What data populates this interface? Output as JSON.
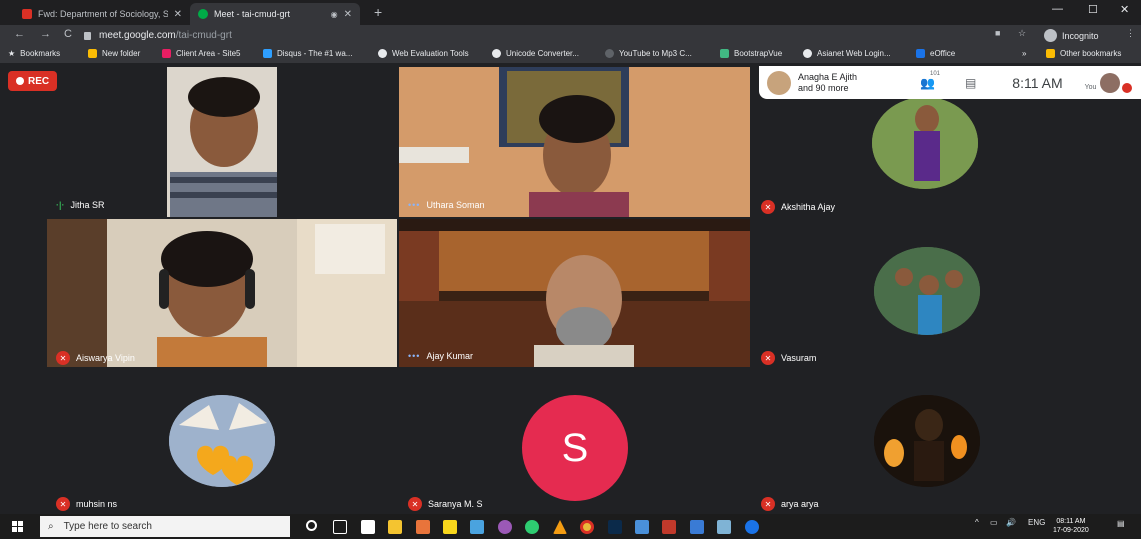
{
  "browser": {
    "tabs": [
      {
        "label": "Fwd: Department of Sociology, S",
        "active": false
      },
      {
        "label": "Meet - tai-cmud-grt",
        "active": true
      }
    ],
    "url_host": "meet.google.com",
    "url_path": "/tai-cmud-grt",
    "profile_label": "Incognito",
    "bookmarks": [
      "Bookmarks",
      "New folder",
      "Client Area - Site5",
      "Disqus - The #1 wa...",
      "Web Evaluation Tools",
      "Unicode Converter...",
      "YouTube to Mp3 C...",
      "BootstrapVue",
      "Asianet Web Login...",
      "eOffice",
      "Other bookmarks"
    ],
    "overflow_chevron": "»"
  },
  "meet": {
    "rec_label": "REC",
    "top_bar": {
      "people_name": "Anagha E Ajith",
      "people_more": "and 90 more",
      "participant_count": "101",
      "time": "8:11 AM",
      "self_label": "You"
    },
    "participants": [
      {
        "name": "Jitha SR",
        "status": "speaking"
      },
      {
        "name": "Uthara Soman",
        "status": "active"
      },
      {
        "name": "Akshitha Ajay",
        "status": "muted"
      },
      {
        "name": "Aiswarya Vipin",
        "status": "muted"
      },
      {
        "name": "Ajay Kumar",
        "status": "active"
      },
      {
        "name": "Vasuram",
        "status": "muted"
      },
      {
        "name": "muhsin ns",
        "status": "muted"
      },
      {
        "name": "Saranya M. S",
        "status": "muted",
        "initial": "S"
      },
      {
        "name": "arya arya",
        "status": "muted"
      }
    ]
  },
  "taskbar": {
    "search_placeholder": "Type here to search",
    "tray_lang": "ENG",
    "tray_arrow": "^",
    "clock_time": "08:11 AM",
    "clock_date": "17-09-2020"
  },
  "colors": {
    "meet_bg": "#202124",
    "rec_red": "#d93025",
    "avatar_pink": "#e52b50"
  }
}
